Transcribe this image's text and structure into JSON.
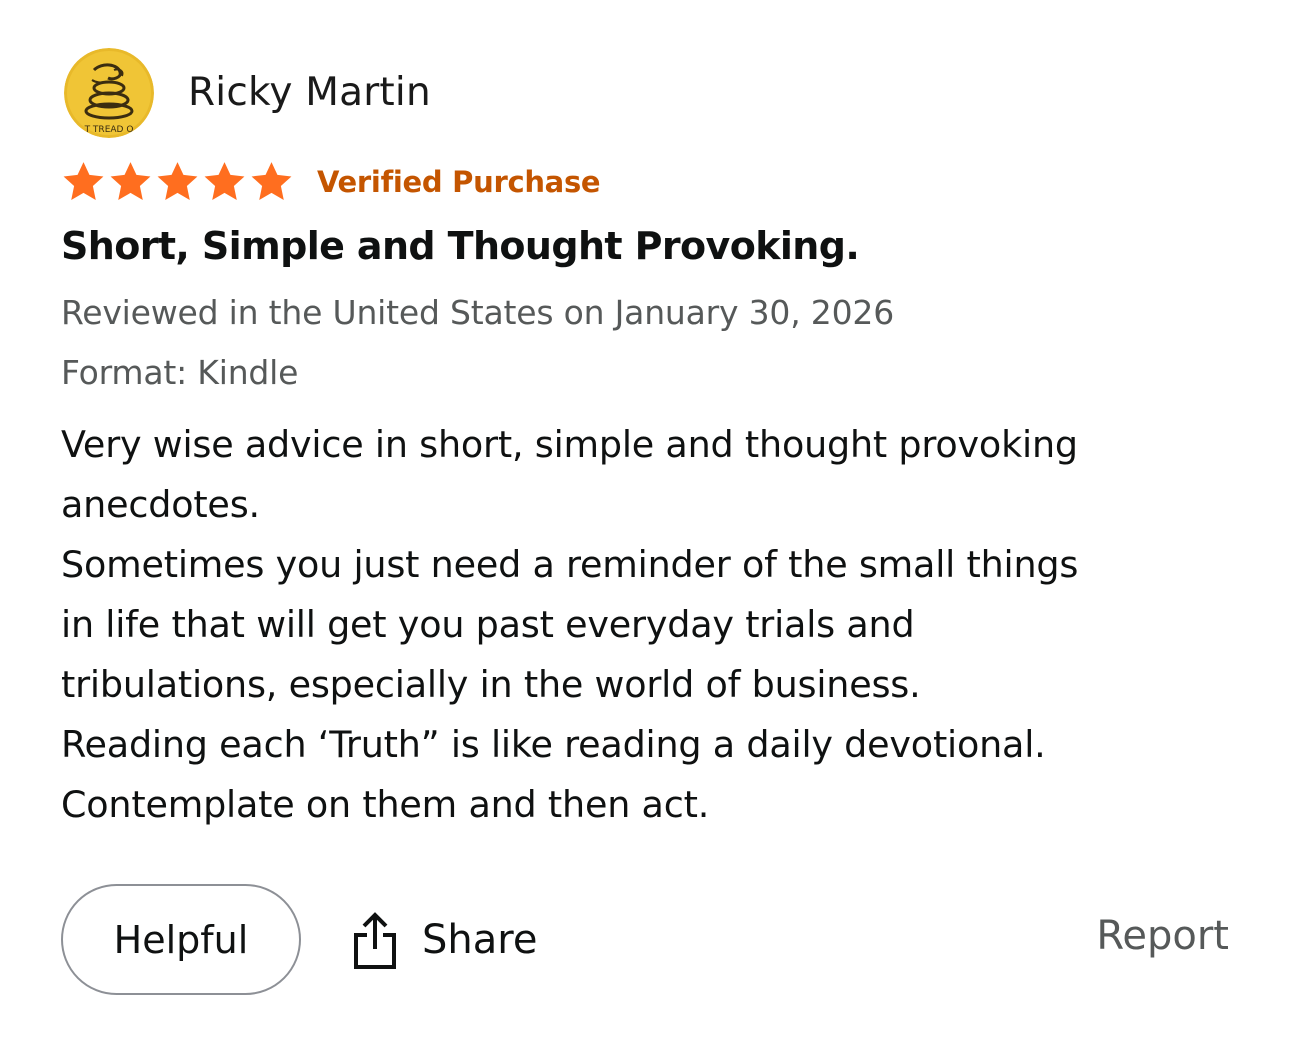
{
  "review": {
    "reviewer_name": "Ricky Martin",
    "avatar": {
      "icon": "coiled-snake-flag-avatar",
      "text": "T TREAD O",
      "colors": {
        "background": "#e8b92a",
        "border_ring": "#f4e08a",
        "detail": "#3b2d10"
      }
    },
    "rating": {
      "stars": 5,
      "max_stars": 5,
      "color": "#ff6e1f"
    },
    "verified_label": "Verified Purchase",
    "verified_color": "#c45500",
    "title": "Short, Simple and Thought Provoking.",
    "date_line": "Reviewed in the United States on January 30, 2026",
    "format_line": "Format: Kindle",
    "body_lines": [
      "Very wise advice in short, simple and thought provoking",
      "anecdotes.",
      "Sometimes you just need a reminder of the small things",
      "in life that will get you past everyday trials and",
      "tribulations, especially in the world of business.",
      "Reading each ‘Truth” is like reading a daily devotional.",
      "Contemplate on them and then act."
    ]
  },
  "actions": {
    "helpful_label": "Helpful",
    "share_label": "Share",
    "share_icon": "share-icon",
    "report_label": "Report"
  },
  "colors": {
    "text_primary": "#0f1111",
    "text_secondary": "#565959",
    "button_border": "#8d9096"
  }
}
